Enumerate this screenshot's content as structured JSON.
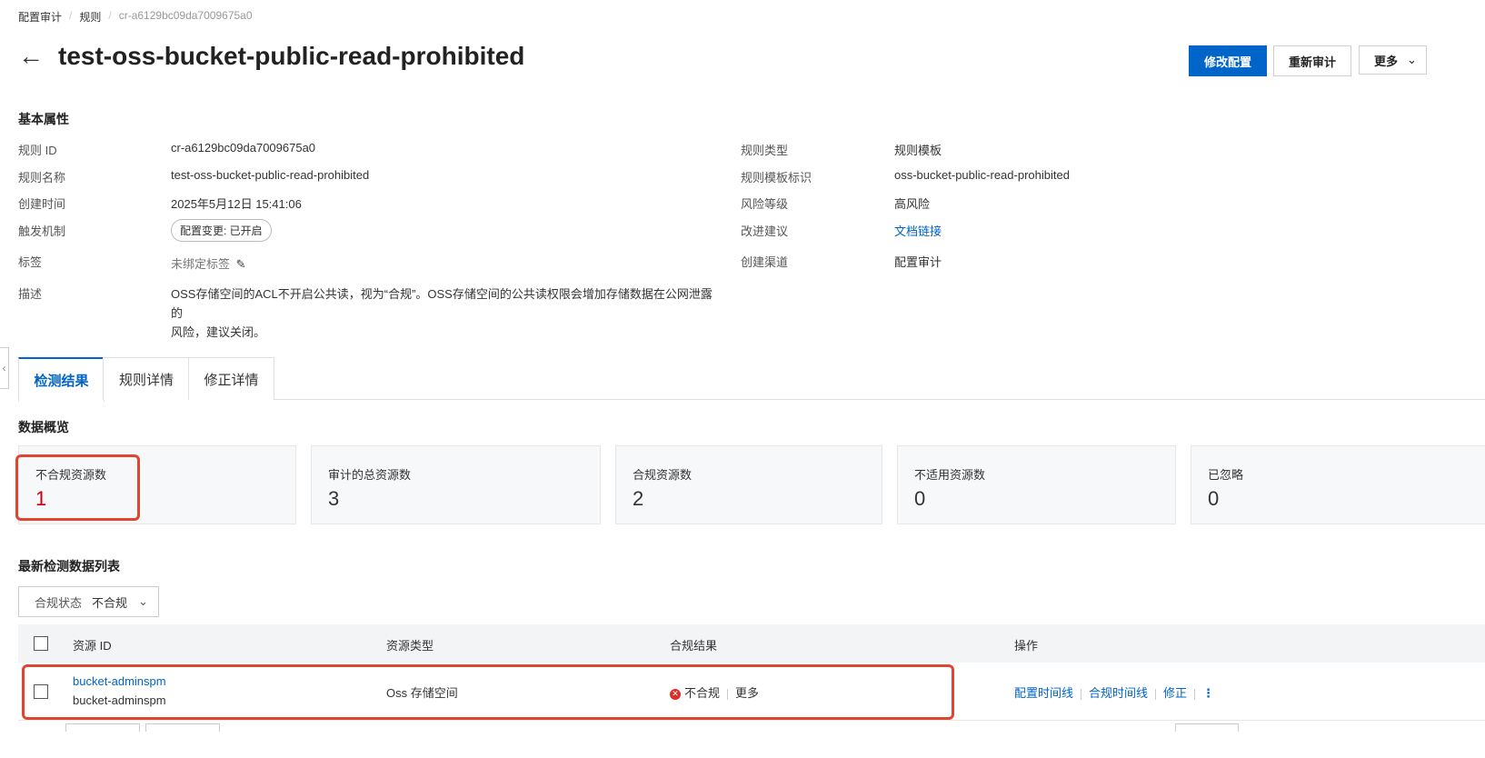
{
  "breadcrumb": {
    "items": [
      "配置审计",
      "规则",
      "cr-a6129bc09da7009675a0"
    ]
  },
  "header": {
    "title": "test-oss-bucket-public-read-prohibited",
    "buttons": {
      "edit": "修改配置",
      "reaudit": "重新审计",
      "more": "更多"
    }
  },
  "basic": {
    "section_title": "基本属性",
    "left": {
      "rule_id_label": "规则 ID",
      "rule_id": "cr-a6129bc09da7009675a0",
      "rule_name_label": "规则名称",
      "rule_name": "test-oss-bucket-public-read-prohibited",
      "created_label": "创建时间",
      "created": "2025年5月12日 15:41:06",
      "trigger_label": "触发机制",
      "trigger": "配置变更: 已开启",
      "tags_label": "标签",
      "tags": "未绑定标签",
      "desc_label": "描述",
      "desc_line1": "OSS存储空间的ACL不开启公共读，视为“合规”。OSS存储空间的公共读权限会增加存储数据在公网泄露的",
      "desc_line2": "风险，建议关闭。"
    },
    "right": {
      "type_label": "规则类型",
      "type": "规则模板",
      "template_label": "规则模板标识",
      "template": "oss-bucket-public-read-prohibited",
      "risk_label": "风险等级",
      "risk": "高风险",
      "advice_label": "改进建议",
      "advice": "文档链接",
      "channel_label": "创建渠道",
      "channel": "配置审计"
    }
  },
  "tabs": [
    "检测结果",
    "规则详情",
    "修正详情"
  ],
  "overview": {
    "title": "数据概览",
    "cards": [
      {
        "label": "不合规资源数",
        "value": "1"
      },
      {
        "label": "审计的总资源数",
        "value": "3"
      },
      {
        "label": "合规资源数",
        "value": "2"
      },
      {
        "label": "不适用资源数",
        "value": "0"
      },
      {
        "label": "已忽略",
        "value": "0"
      }
    ]
  },
  "list": {
    "title": "最新检测数据列表",
    "filter_label": "合规状态",
    "filter_value": "不合规",
    "columns": [
      "资源 ID",
      "资源类型",
      "合规结果",
      "操作"
    ],
    "rows": [
      {
        "id_link": "bucket-adminspm",
        "id_sub": "bucket-adminspm",
        "type": "Oss 存储空间",
        "result": "不合规",
        "result_more": "更多",
        "actions": [
          "配置时间线",
          "合规时间线",
          "修正"
        ]
      }
    ]
  },
  "colors": {
    "primary": "#0064c8",
    "highlight": "#e0462f",
    "danger": "#d93026",
    "noncompliant_value": "#c7000b"
  }
}
